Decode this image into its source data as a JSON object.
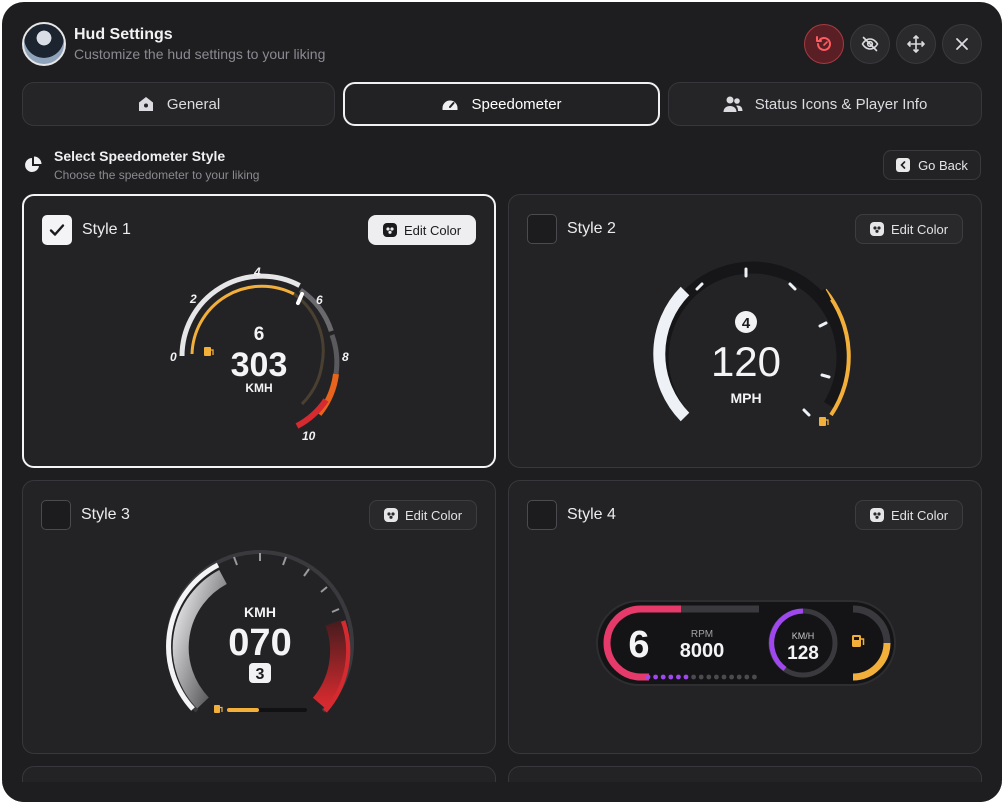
{
  "header": {
    "title": "Hud Settings",
    "subtitle": "Customize the hud settings to your liking"
  },
  "tabs": [
    {
      "label": "General",
      "icon": "home-icon",
      "active": false
    },
    {
      "label": "Speedometer",
      "icon": "speedometer-icon",
      "active": true
    },
    {
      "label": "Status Icons & Player Info",
      "icon": "users-icon",
      "active": false
    }
  ],
  "section": {
    "title": "Select Speedometer Style",
    "subtitle": "Choose the speedometer to your liking",
    "back_label": "Go Back"
  },
  "edit_label": "Edit Color",
  "styles": [
    {
      "label": "Style 1",
      "selected": true,
      "gear": "6",
      "speed": "303",
      "unit": "KMH",
      "ticks": [
        "0",
        "2",
        "4",
        "6",
        "8",
        "10"
      ]
    },
    {
      "label": "Style 2",
      "selected": false,
      "gear": "4",
      "speed": "120",
      "unit": "MPH"
    },
    {
      "label": "Style 3",
      "selected": false,
      "unit": "KMH",
      "speed": "070",
      "gear": "3",
      "fuel_level": 0.4
    },
    {
      "label": "Style 4",
      "selected": false,
      "gear": "6",
      "rpm_label": "RPM",
      "rpm": "8000",
      "unit": "KM/H",
      "speed": "128",
      "rpm_dots_filled": 6,
      "rpm_dots_total": 15
    }
  ],
  "colors": {
    "accent_red": "#d52a2f",
    "accent_orange": "#e8641c",
    "accent_yellow": "#f2b03a",
    "accent_pink": "#e63b6a",
    "accent_purple": "#a048f0"
  }
}
